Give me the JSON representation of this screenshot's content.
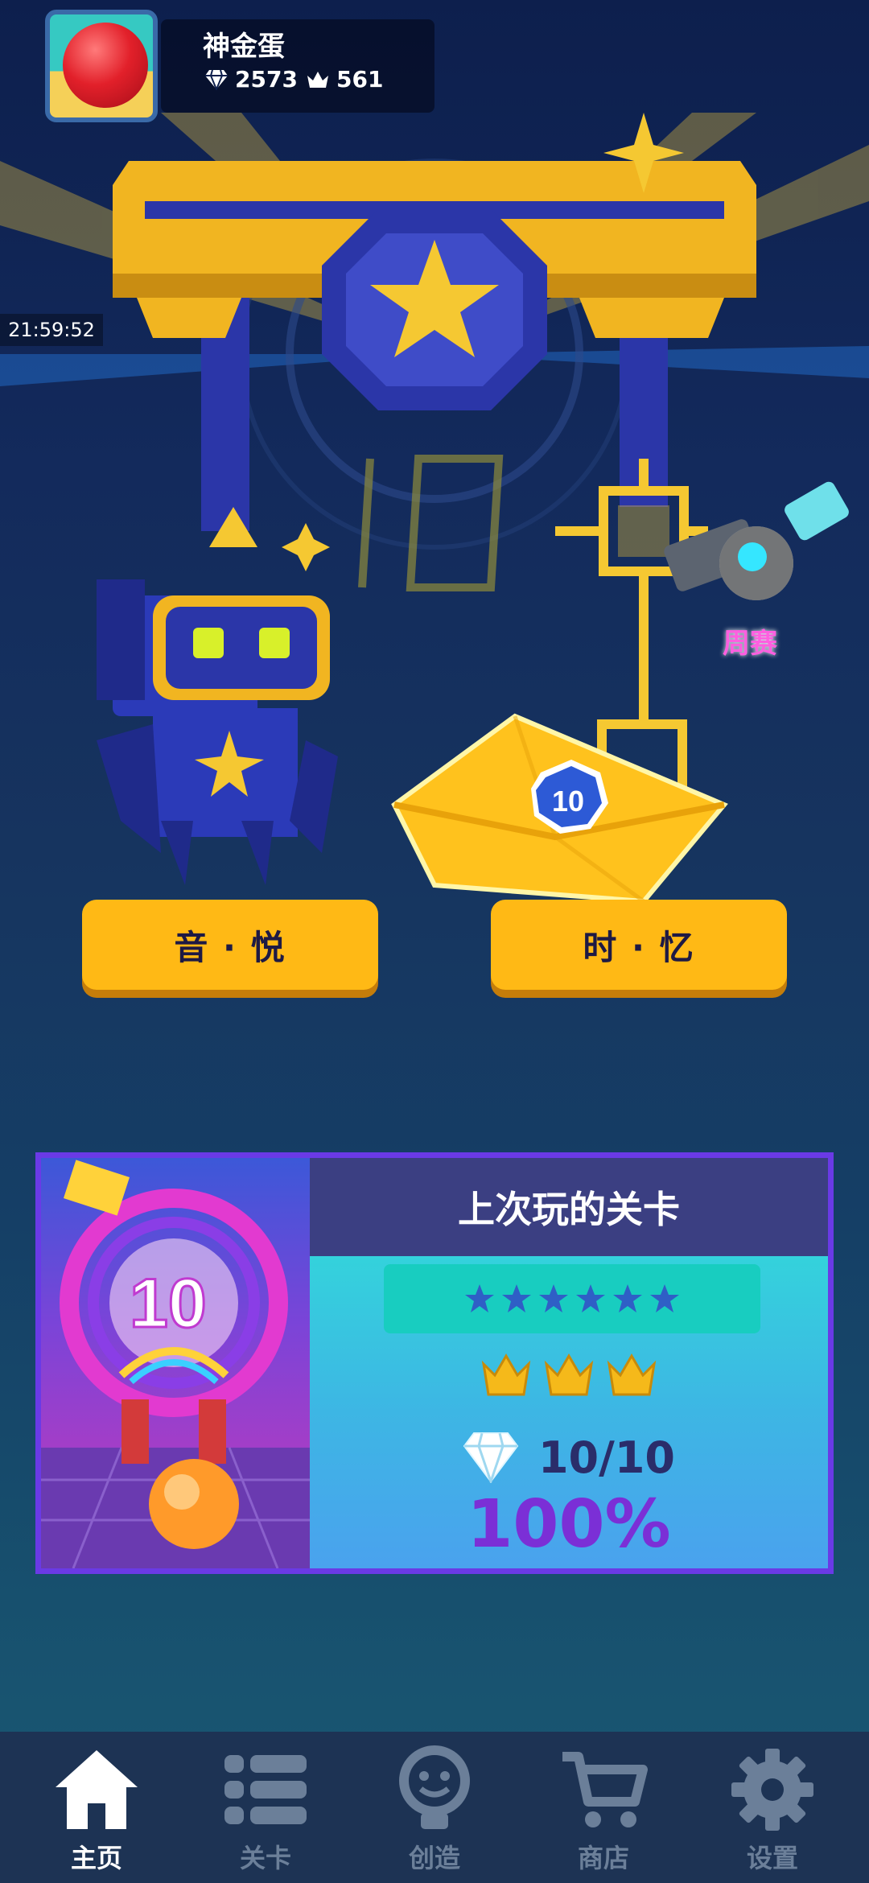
{
  "player": {
    "name": "神金蛋",
    "diamonds": "2573",
    "crowns": "561"
  },
  "clock": "21:59:52",
  "modes": {
    "left": "音 · 悦",
    "right": "时 · 忆"
  },
  "weekly_label": "周赛",
  "last_played": {
    "title": "上次玩的关卡",
    "stars": 6,
    "crowns": 3,
    "gems": "10/10",
    "percent": "100%",
    "thumb_text": "10"
  },
  "nav": {
    "home": "主页",
    "levels": "关卡",
    "create": "创造",
    "shop": "商店",
    "settings": "设置"
  },
  "colors": {
    "accent_yellow": "#ffb915",
    "card_border": "#6a3ae6",
    "percent": "#7b2fd6",
    "nav_bg": "#1d3354"
  }
}
